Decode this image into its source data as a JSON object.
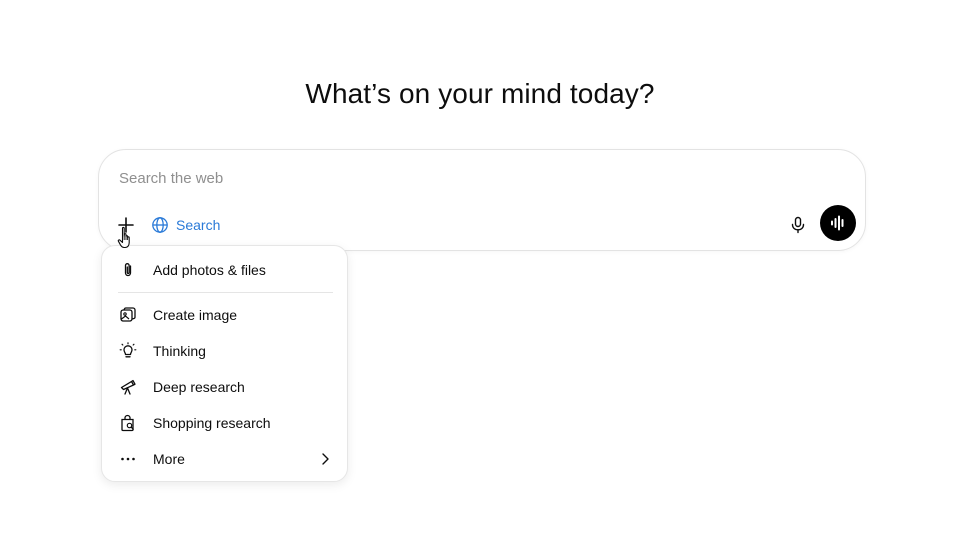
{
  "headline": "What’s on your mind today?",
  "composer": {
    "placeholder": "Search the web",
    "value": "",
    "search_chip_label": "Search"
  },
  "menu": {
    "items": [
      {
        "label": "Add photos & files",
        "icon": "paperclip-icon"
      },
      {
        "label": "Create image",
        "icon": "image-icon"
      },
      {
        "label": "Thinking",
        "icon": "lightbulb-icon"
      },
      {
        "label": "Deep research",
        "icon": "telescope-icon"
      },
      {
        "label": "Shopping research",
        "icon": "shopping-bag-icon"
      },
      {
        "label": "More",
        "icon": "more-dots-icon"
      }
    ]
  },
  "colors": {
    "accent": "#2a7ad8",
    "voice_button": "#000000",
    "text": "#0d0d0d",
    "placeholder": "#8f8f8f"
  }
}
